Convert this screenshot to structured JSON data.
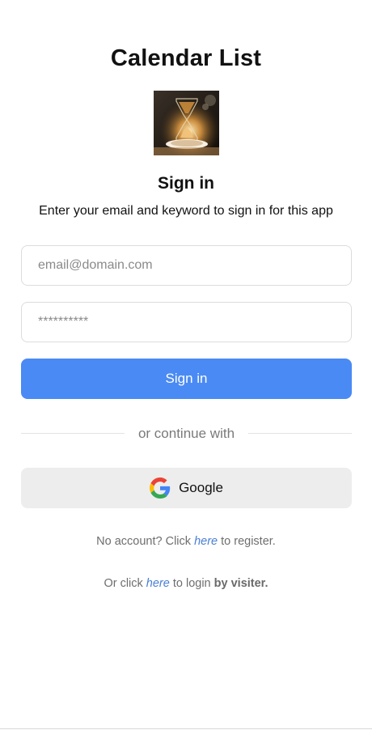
{
  "app": {
    "title": "Calendar List"
  },
  "logo": {
    "name": "hourglass-image"
  },
  "signin": {
    "heading": "Sign in",
    "description": "Enter your email and keyword to sign in for this app",
    "email_placeholder": "email@domain.com",
    "password_placeholder": "**********",
    "submit_label": "Sign in",
    "divider_text": "or continue with",
    "google_label": "Google",
    "google_icon": "google-icon"
  },
  "register": {
    "prefix": "No account? Click ",
    "link": "here",
    "suffix": " to register."
  },
  "visitor": {
    "prefix": "Or click ",
    "link": "here",
    "middle": " to login ",
    "bold": "by visiter."
  },
  "colors": {
    "primary": "#4a8af4",
    "link": "#4a7fd4",
    "google_bg": "#ededed"
  }
}
